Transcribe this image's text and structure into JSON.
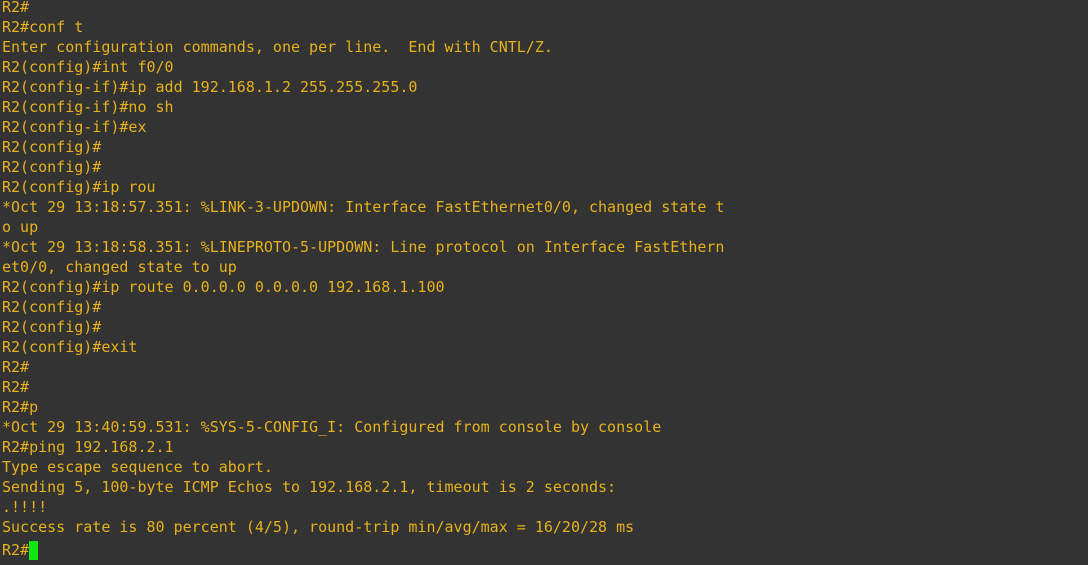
{
  "terminal": {
    "lines": [
      "R2#",
      "R2#conf t",
      "Enter configuration commands, one per line.  End with CNTL/Z.",
      "R2(config)#int f0/0",
      "R2(config-if)#ip add 192.168.1.2 255.255.255.0",
      "R2(config-if)#no sh",
      "R2(config-if)#ex",
      "R2(config)#",
      "R2(config)#",
      "R2(config)#ip rou",
      "*Oct 29 13:18:57.351: %LINK-3-UPDOWN: Interface FastEthernet0/0, changed state t",
      "o up",
      "*Oct 29 13:18:58.351: %LINEPROTO-5-UPDOWN: Line protocol on Interface FastEthern",
      "et0/0, changed state to up",
      "R2(config)#ip route 0.0.0.0 0.0.0.0 192.168.1.100",
      "R2(config)#",
      "R2(config)#",
      "R2(config)#exit",
      "R2#",
      "R2#",
      "R2#p",
      "*Oct 29 13:40:59.531: %SYS-5-CONFIG_I: Configured from console by console",
      "R2#ping 192.168.2.1",
      "Type escape sequence to abort.",
      "Sending 5, 100-byte ICMP Echos to 192.168.2.1, timeout is 2 seconds:",
      ".!!!!",
      "Success rate is 80 percent (4/5), round-trip min/avg/max = 16/20/28 ms"
    ],
    "current_prompt": "R2#",
    "colors": {
      "background": "#333334",
      "text": "#e7b21c",
      "cursor": "#11e811"
    }
  }
}
